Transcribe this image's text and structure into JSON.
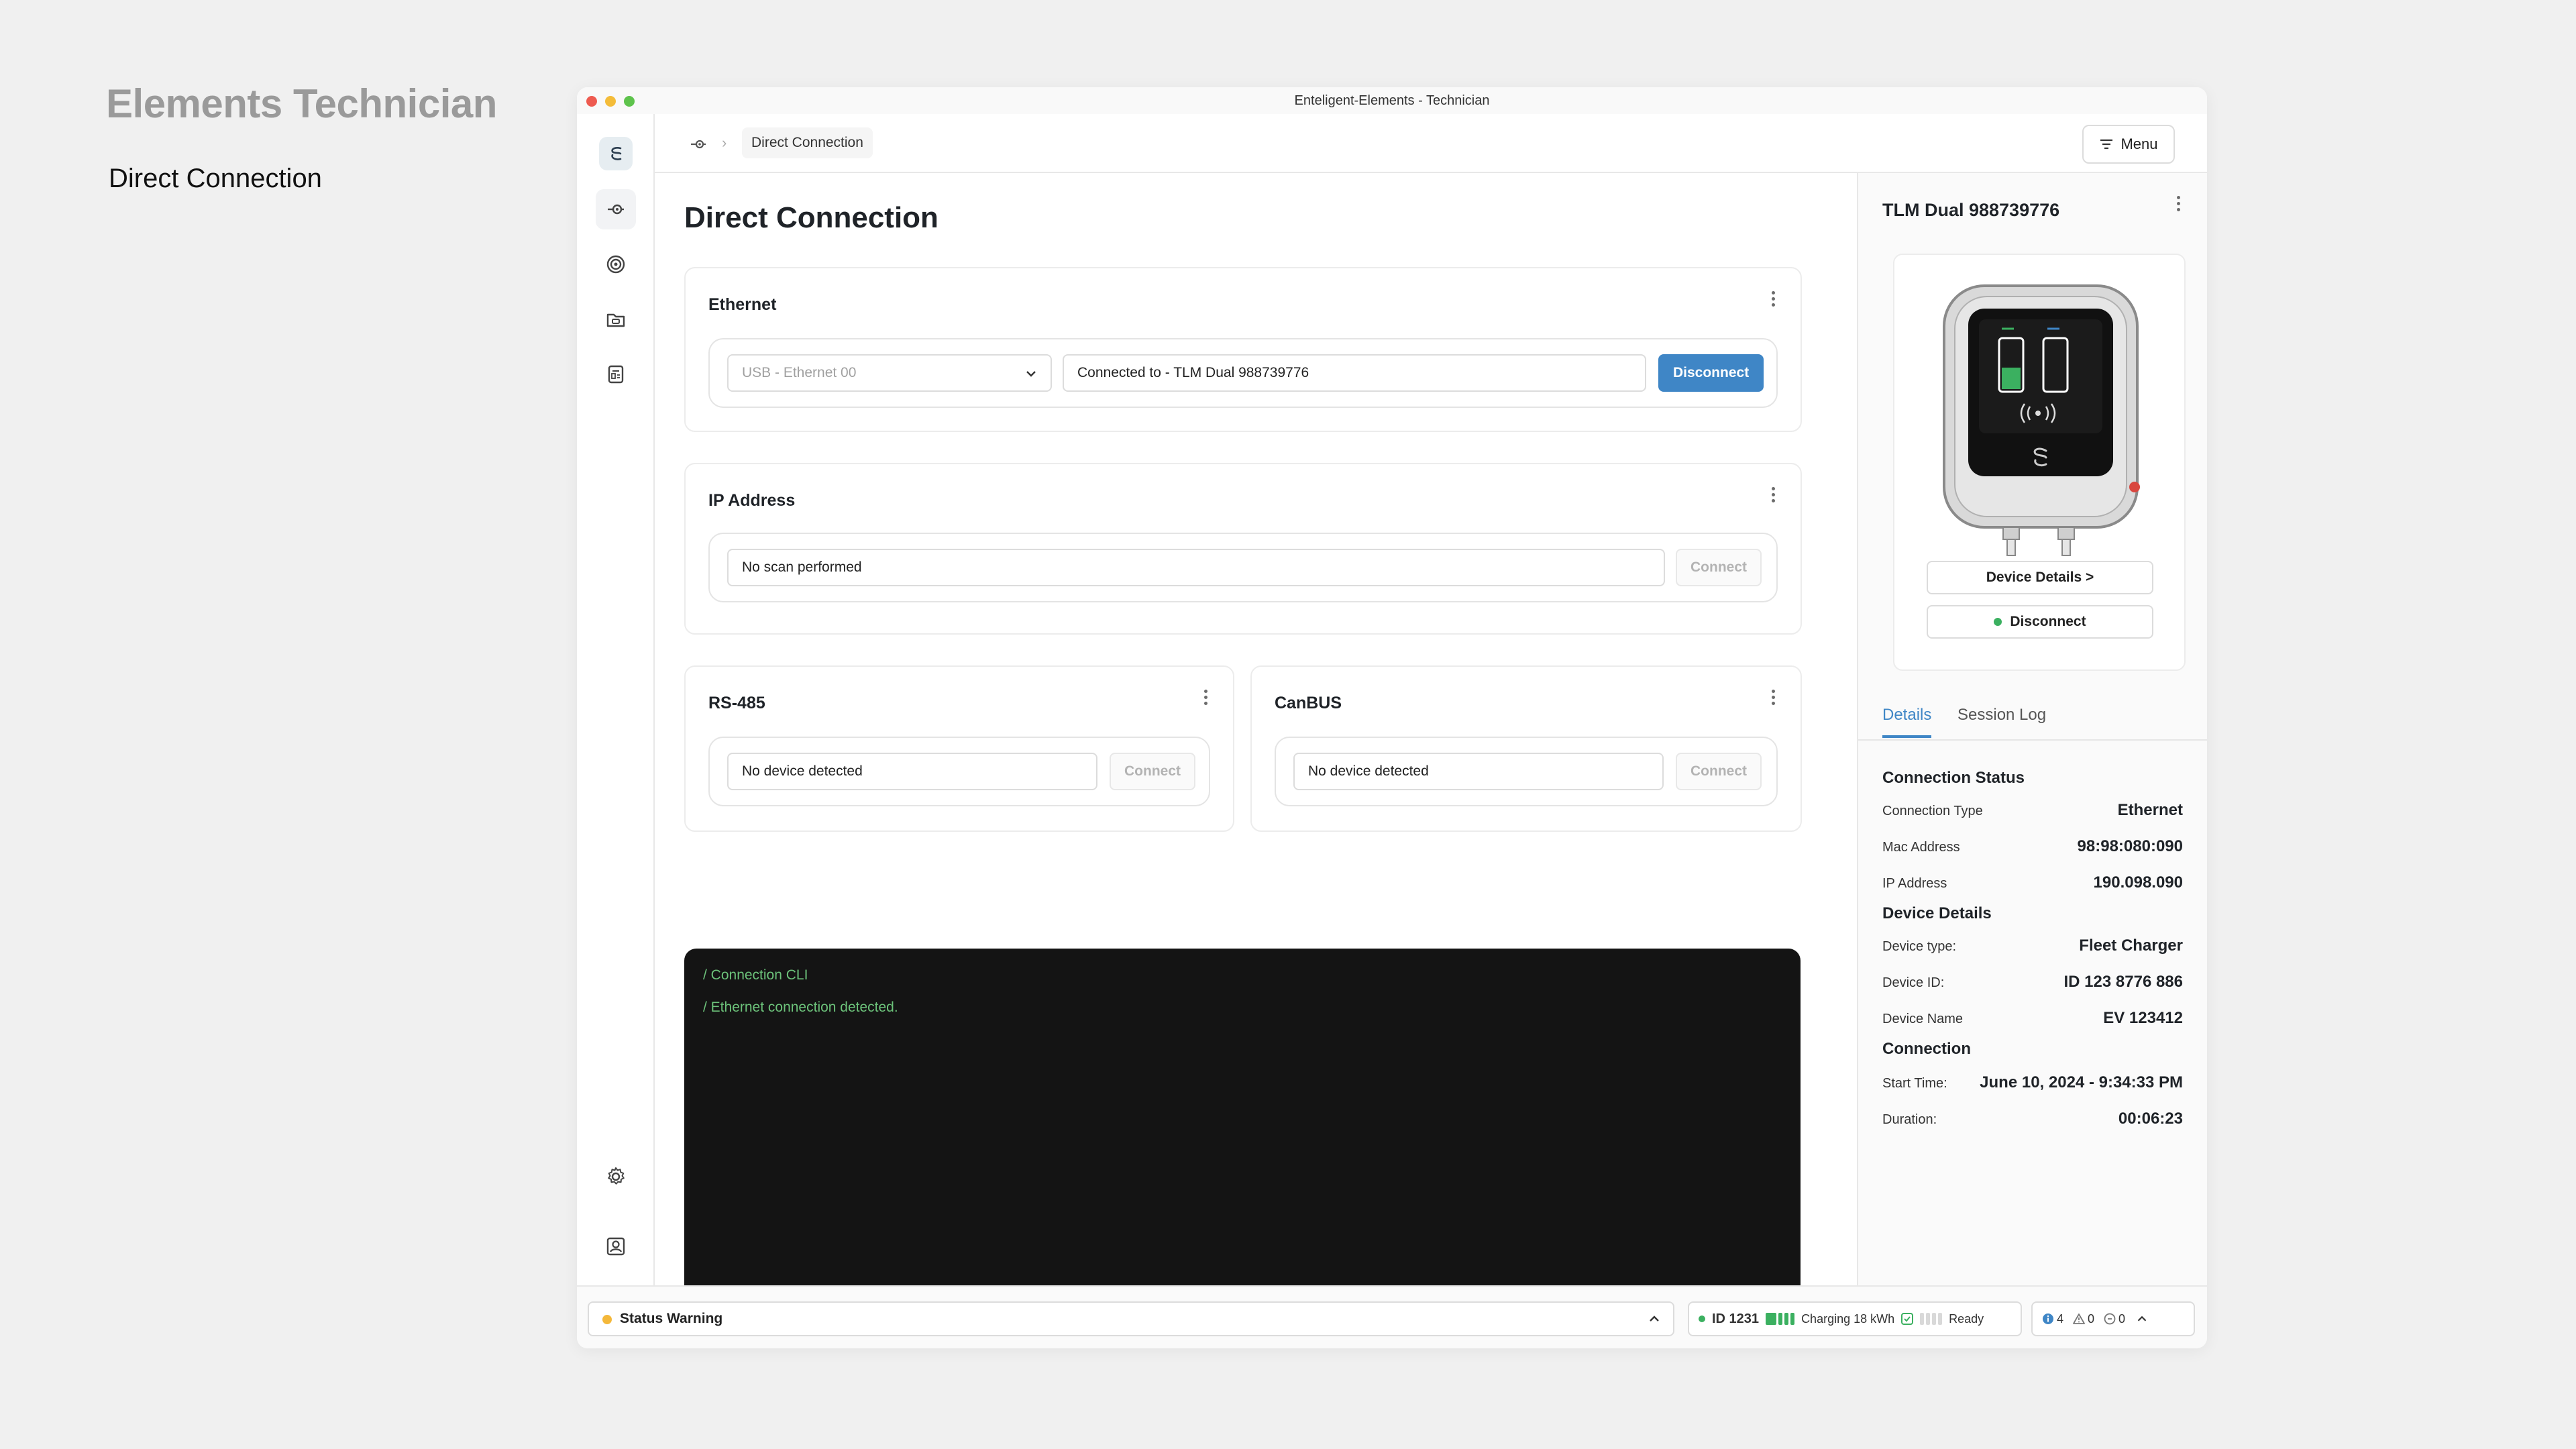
{
  "page": {
    "heading": "Elements Technician",
    "subheading": "Direct Connection"
  },
  "window": {
    "title": "Enteligent-Elements - Technician"
  },
  "topbar": {
    "breadcrumb_current": "Direct Connection",
    "breadcrumb_sep": "›",
    "menu_label": "Menu"
  },
  "main": {
    "title": "Direct Connection",
    "ethernet": {
      "title": "Ethernet",
      "interface_select": "USB - Ethernet 00",
      "status_value": "Connected to - TLM Dual 988739776",
      "action_label": "Disconnect"
    },
    "ip": {
      "title": "IP Address",
      "status_value": "No scan performed",
      "action_label": "Connect"
    },
    "rs485": {
      "title": "RS-485",
      "status_value": "No device detected",
      "action_label": "Connect"
    },
    "canbus": {
      "title": "CanBUS",
      "status_value": "No device detected",
      "action_label": "Connect"
    },
    "cli": {
      "lines": [
        "/ Connection CLI",
        "/ Ethernet connection detected."
      ]
    }
  },
  "side": {
    "device_name": "TLM Dual 988739776",
    "device_details_btn": "Device Details >",
    "disconnect_btn": "Disconnect",
    "tabs": [
      {
        "label": "Details",
        "active": true
      },
      {
        "label": "Session Log",
        "active": false
      }
    ],
    "connection_status": {
      "title": "Connection Status",
      "rows": [
        {
          "label": "Connection Type",
          "value": "Ethernet"
        },
        {
          "label": "Mac Address",
          "value": "98:98:080:090"
        },
        {
          "label": "IP Address",
          "value": "190.098.090"
        }
      ]
    },
    "device_details": {
      "title": "Device Details",
      "rows": [
        {
          "label": "Device type:",
          "value": "Fleet Charger"
        },
        {
          "label": "Device ID:",
          "value": "ID 123 8776 886"
        },
        {
          "label": "Device Name",
          "value": "EV 123412"
        }
      ]
    },
    "connection": {
      "title": "Connection",
      "rows": [
        {
          "label": "Start Time:",
          "value": "June 10, 2024 - 9:34:33 PM"
        },
        {
          "label": "Duration:",
          "value": "00:06:23"
        }
      ]
    }
  },
  "statusbar": {
    "warning_text": "Status Warning",
    "device_id": "ID 1231",
    "charging_text": "Charging 18 kWh",
    "ready_text": "Ready",
    "info_count": "4",
    "warning_count": "0",
    "error_count": "0"
  },
  "colors": {
    "accent": "#3f86c6",
    "cli_bg": "#141414",
    "cli_text": "#6cc27a",
    "warning": "#f4b83a",
    "ok": "#3bb060"
  }
}
